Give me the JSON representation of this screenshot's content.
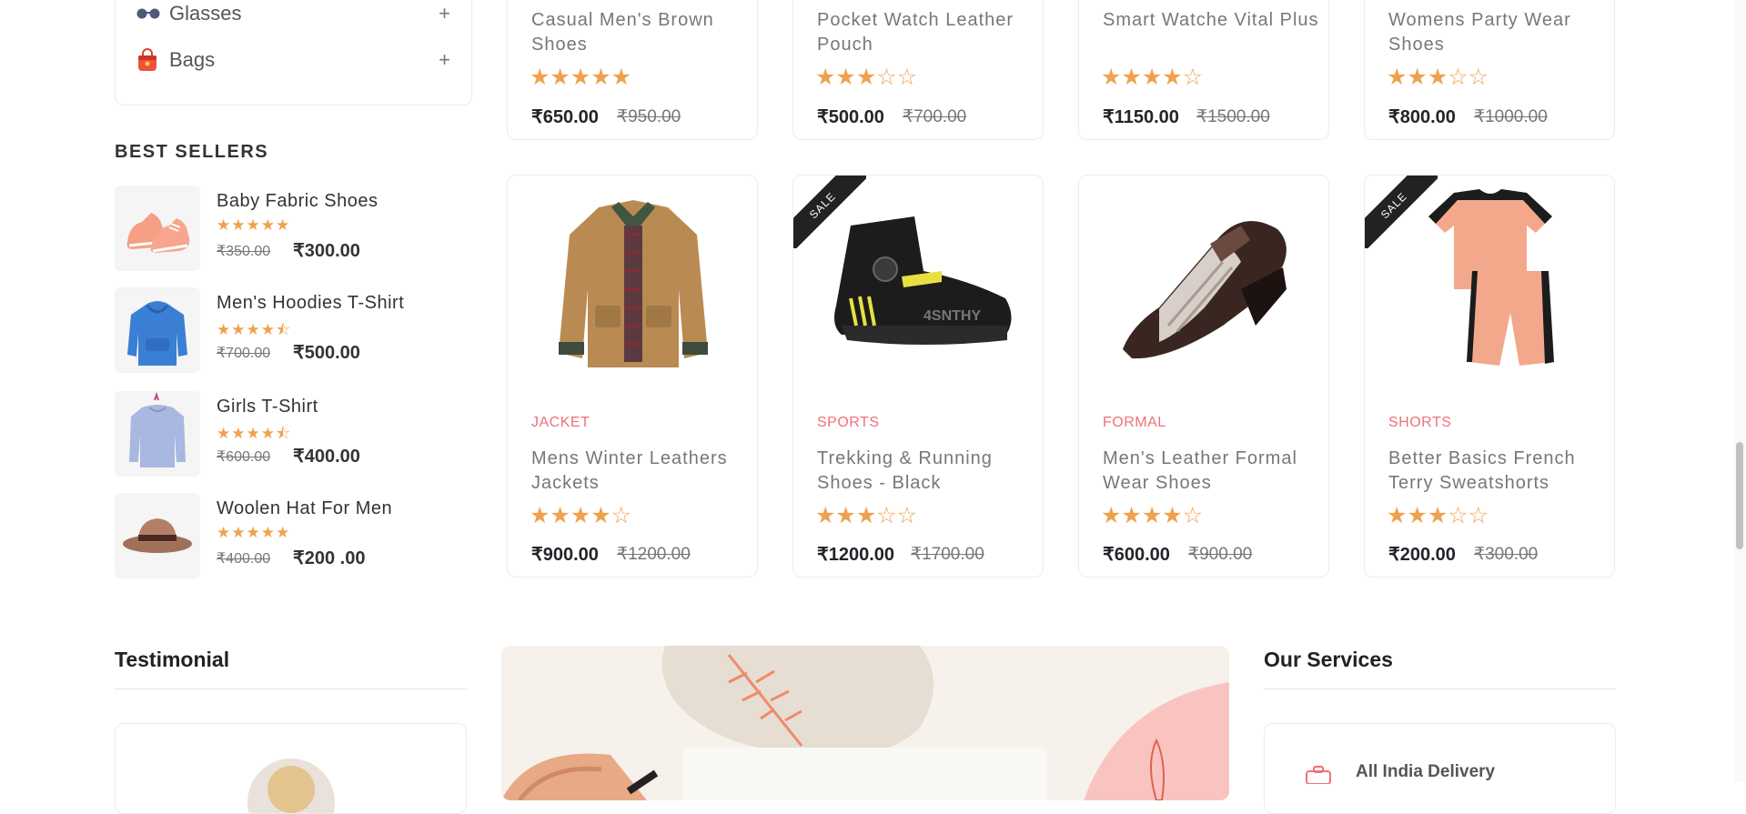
{
  "sidebar": {
    "categories": [
      {
        "label": "Glasses",
        "icon": "glasses-icon"
      },
      {
        "label": "Bags",
        "icon": "bag-icon"
      }
    ],
    "best_sellers_title": "BEST SELLERS",
    "best_sellers": [
      {
        "name": "Baby Fabric Shoes",
        "stars": "★★★★★",
        "rating": 5,
        "old_price": "₹350.00",
        "price": "₹300.00",
        "image": "baby-shoes"
      },
      {
        "name": "Men's Hoodies T-Shirt",
        "stars": "★★★★⯪",
        "rating": 4.5,
        "old_price": "₹700.00",
        "price": "₹500.00",
        "image": "hoodie"
      },
      {
        "name": "Girls T-Shirt",
        "stars": "★★★★⯪",
        "rating": 4.5,
        "old_price": "₹600.00",
        "price": "₹400.00",
        "image": "sweater"
      },
      {
        "name": "Woolen Hat For Men",
        "stars": "★★★★★",
        "rating": 5,
        "old_price": "₹400.00",
        "price": "₹200 .00",
        "image": "hat"
      }
    ]
  },
  "products_top": [
    {
      "name": "Casual Men's Brown Shoes",
      "stars": "★★★★★",
      "rating": 5,
      "price": "₹650.00",
      "old_price": "₹950.00"
    },
    {
      "name": "Pocket Watch Leather Pouch",
      "stars": "★★★☆☆",
      "rating": 3,
      "price": "₹500.00",
      "old_price": "₹700.00"
    },
    {
      "name": "Smart Watche Vital Plus",
      "stars": "★★★★☆",
      "rating": 4,
      "price": "₹1150.00",
      "old_price": "₹1500.00"
    },
    {
      "name": "Womens Party Wear Shoes",
      "stars": "★★★☆☆",
      "rating": 3,
      "price": "₹800.00",
      "old_price": "₹1000.00"
    }
  ],
  "products": [
    {
      "category": "JACKET",
      "name": "Mens Winter Leathers Jackets",
      "stars": "★★★★☆",
      "rating": 4,
      "price": "₹900.00",
      "old_price": "₹1200.00",
      "sale": false,
      "image": "jacket"
    },
    {
      "category": "SPORTS",
      "name": "Trekking & Running Shoes - Black",
      "stars": "★★★☆☆",
      "rating": 3,
      "price": "₹1200.00",
      "old_price": "₹1700.00",
      "sale": true,
      "sale_label": "SALE",
      "image": "sports-shoe"
    },
    {
      "category": "FORMAL",
      "name": "Men's Leather Formal Wear Shoes",
      "stars": "★★★★☆",
      "rating": 4,
      "price": "₹600.00",
      "old_price": "₹900.00",
      "sale": false,
      "image": "formal-shoe"
    },
    {
      "category": "SHORTS",
      "name": "Better Basics French Terry Sweatshorts",
      "stars": "★★★☆☆",
      "rating": 3,
      "price": "₹200.00",
      "old_price": "₹300.00",
      "sale": true,
      "sale_label": "SALE",
      "image": "shorts-set"
    }
  ],
  "testimonial": {
    "title": "Testimonial"
  },
  "services": {
    "title": "Our Services",
    "first_item": "All India Delivery"
  },
  "colors": {
    "accent": "#f0707a",
    "star": "#f0a14e",
    "text": "#212529",
    "muted": "#777777"
  }
}
